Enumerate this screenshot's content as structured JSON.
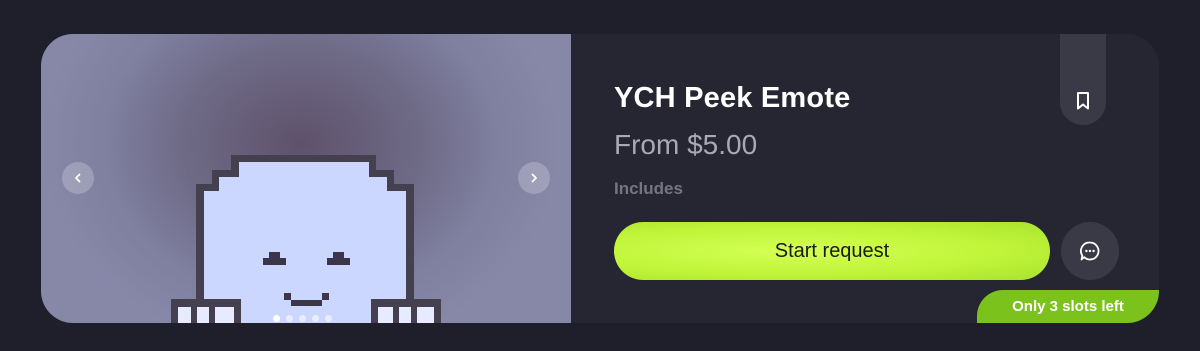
{
  "listing": {
    "title": "YCH Peek Emote",
    "price": "From $5.00",
    "includes_label": "Includes",
    "cta_label": "Start request",
    "slots_badge": "Only 3 slots left"
  },
  "gallery": {
    "image_count": 5,
    "active_index": 0,
    "prev_icon": "chevron-left-icon",
    "next_icon": "chevron-right-icon"
  },
  "icons": {
    "bookmark": "bookmark-icon",
    "chat": "chat-bubble-icon"
  },
  "colors": {
    "page_bg": "#1f1f2b",
    "card_bg": "#262633",
    "accent": "#c0f53a",
    "badge": "#7cc21c",
    "ghost_body": "#ccd7ff",
    "ghost_outline": "#44404f"
  }
}
